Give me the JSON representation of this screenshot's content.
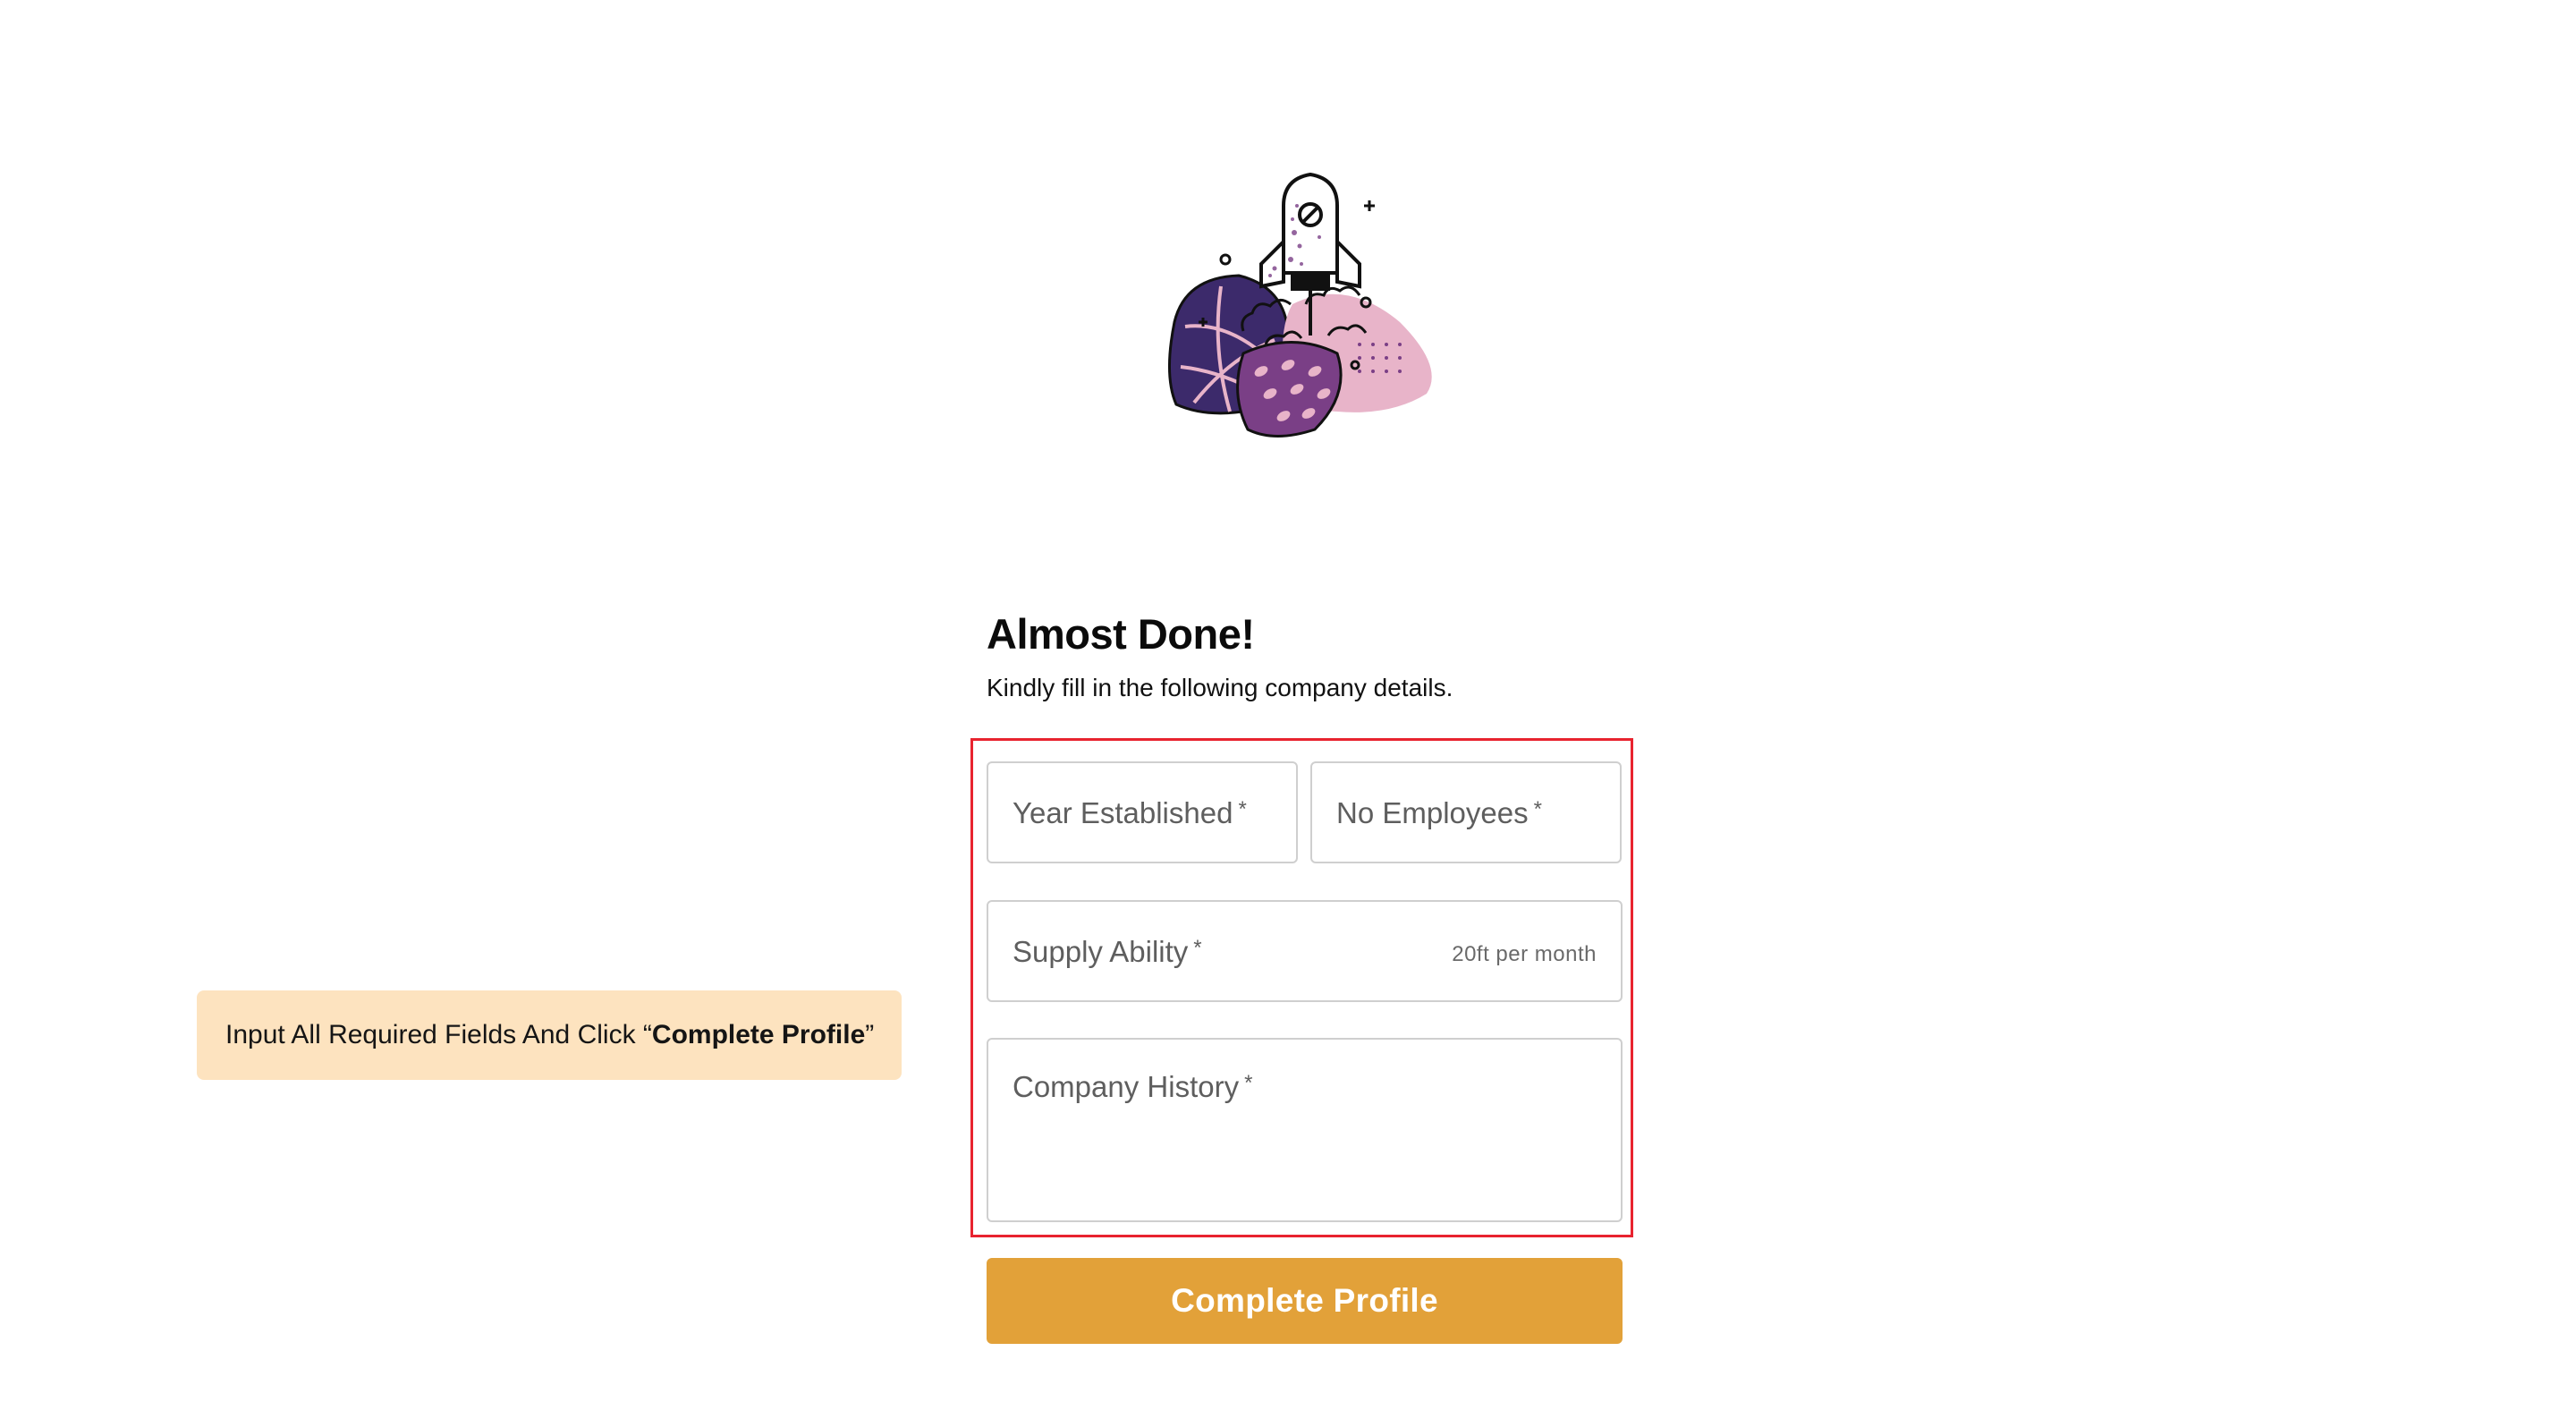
{
  "header": {
    "illustration": "rocket-launch-illustration",
    "title": "Almost Done!",
    "subtitle": "Kindly fill in the following company details."
  },
  "form": {
    "year_established": {
      "label": "Year Established",
      "required_mark": "*",
      "value": ""
    },
    "no_employees": {
      "label": "No Employees",
      "required_mark": "*",
      "value": ""
    },
    "supply_ability": {
      "label": "Supply Ability",
      "required_mark": "*",
      "hint": "20ft per month",
      "value": ""
    },
    "company_history": {
      "label": "Company History",
      "required_mark": "*",
      "value": ""
    },
    "submit_label": "Complete Profile"
  },
  "callout": {
    "prefix": "Input All Required Fields And Click “",
    "emphasis": "Complete Profile",
    "suffix": "”"
  },
  "colors": {
    "accent": "#e2a139",
    "highlight": "#e8232f",
    "callout_bg": "#fde3bf",
    "illustration_dark_purple": "#3c2a6b",
    "illustration_purple": "#7a3f86",
    "illustration_pink": "#e8b4c9"
  }
}
